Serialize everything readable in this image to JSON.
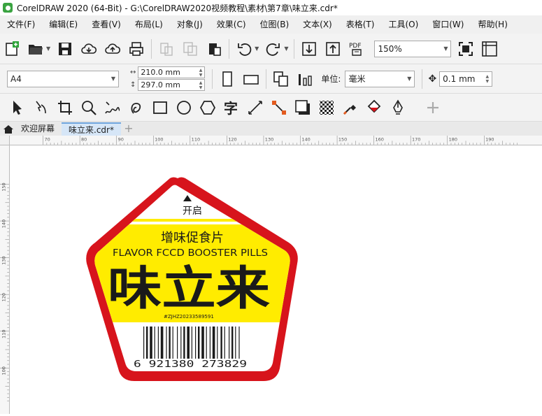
{
  "window": {
    "title": "CorelDRAW 2020 (64-Bit) - G:\\CorelDRAW2020视频教程\\素材\\第7章\\味立来.cdr*"
  },
  "menu": [
    "文件(F)",
    "编辑(E)",
    "查看(V)",
    "布局(L)",
    "对象(J)",
    "效果(C)",
    "位图(B)",
    "文本(X)",
    "表格(T)",
    "工具(O)",
    "窗口(W)",
    "帮助(H)"
  ],
  "toolbar": {
    "zoom": "150%"
  },
  "property_bar": {
    "page_size": "A4",
    "width": "210.0 mm",
    "height": "297.0 mm",
    "unit_label": "单位:",
    "unit": "毫米",
    "nudge": "0.1 mm"
  },
  "tabs": {
    "welcome": "欢迎屏幕",
    "document": "味立来.cdr*"
  },
  "ruler": {
    "top": [
      "70",
      "80",
      "90",
      "100",
      "110",
      "120",
      "130",
      "140",
      "150",
      "160",
      "170",
      "180",
      "190"
    ],
    "left": [
      "150",
      "140",
      "130",
      "120",
      "110",
      "100"
    ]
  },
  "label": {
    "open_text": "开启",
    "cn_subtitle": "增味促食片",
    "en_subtitle": "FLAVOR FCCD BOOSTER PILLS",
    "brand": "味立来",
    "code": "#ZJHZ20233589591",
    "barcode_digits": "6  921380  273829",
    "colors": {
      "border": "#d7141c",
      "yellow": "#ffec00",
      "text": "#1a1a1a"
    }
  }
}
